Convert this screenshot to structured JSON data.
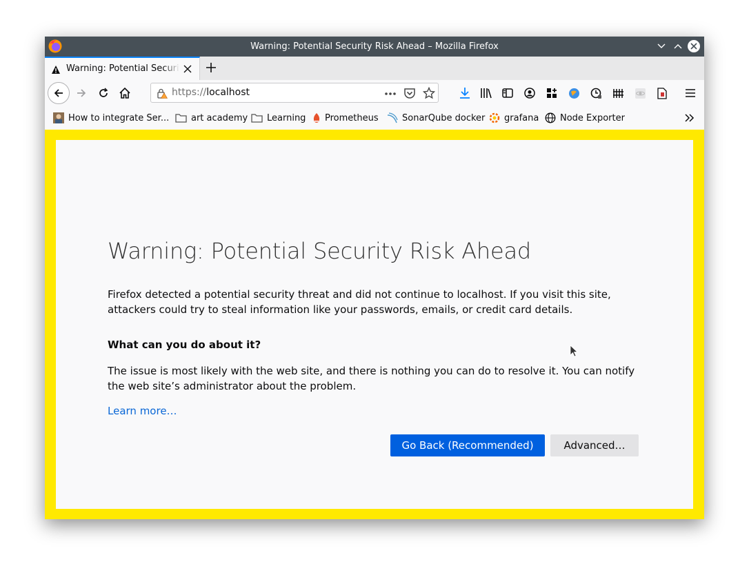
{
  "window": {
    "title": "Warning: Potential Security Risk Ahead – Mozilla Firefox"
  },
  "tabs": [
    {
      "label": "Warning: Potential Security Risk Ahead",
      "active": true
    }
  ],
  "navbar": {
    "url_scheme": "https://",
    "url_host": "localhost"
  },
  "bookmarks": [
    {
      "label": "How to integrate Ser...",
      "icon": "avatar-icon"
    },
    {
      "label": "art academy",
      "icon": "folder-icon"
    },
    {
      "label": "Learning",
      "icon": "folder-icon"
    },
    {
      "label": "Prometheus",
      "icon": "prometheus-icon"
    },
    {
      "label": "SonarQube docker",
      "icon": "sonarqube-icon"
    },
    {
      "label": "grafana",
      "icon": "grafana-icon"
    },
    {
      "label": "Node Exporter",
      "icon": "globe-icon"
    }
  ],
  "error_page": {
    "title": "Warning: Potential Security Risk Ahead",
    "paragraph1": "Firefox detected a potential security threat and did not continue to localhost. If you visit this site, attackers could try to steal information like your passwords, emails, or credit card details.",
    "question": "What can you do about it?",
    "paragraph2": "The issue is most likely with the web site, and there is nothing you can do to resolve it. You can notify the web site’s administrator about the problem.",
    "learn_more": "Learn more…",
    "go_back_label": "Go Back (Recommended)",
    "advanced_label": "Advanced…"
  },
  "colors": {
    "frame_highlight": "#ffe900",
    "primary_button": "#0060df",
    "titlebar": "#475057",
    "link": "#0a67d6"
  }
}
